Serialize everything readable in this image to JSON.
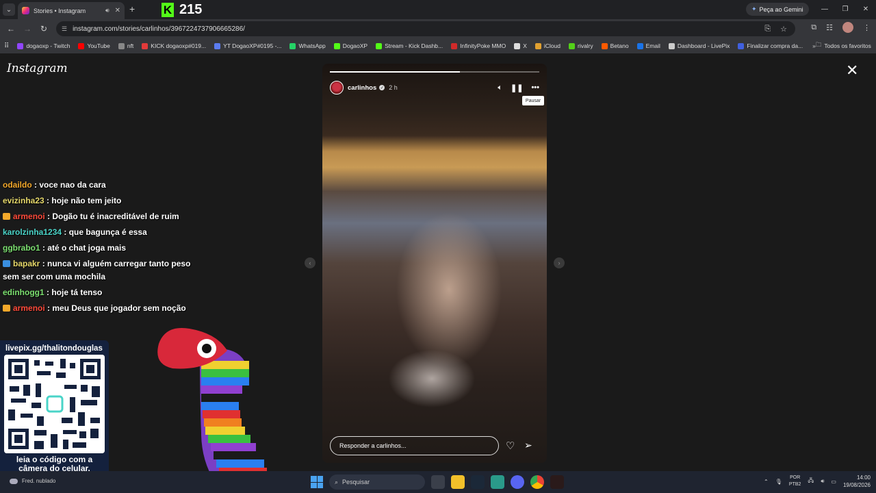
{
  "browser": {
    "tab_title": "Stories • Instagram",
    "new_tab": "+",
    "kick_count": "215",
    "gemini_label": "Peça ao Gemini",
    "url": "instagram.com/stories/carlinhos/3967224737906665286/",
    "bookmarks": [
      {
        "label": "dogaoxp - Twitch",
        "color": "#9146ff"
      },
      {
        "label": "YouTube",
        "color": "#ff0000"
      },
      {
        "label": "nft",
        "color": "#888888"
      },
      {
        "label": "KICK dogaoxp#019...",
        "color": "#e23a3a"
      },
      {
        "label": "YT DogaoXP#0195 -...",
        "color": "#5b7cf0"
      },
      {
        "label": "WhatsApp",
        "color": "#25d366"
      },
      {
        "label": "DogaoXP",
        "color": "#53fc18"
      },
      {
        "label": "Stream - Kick Dashb...",
        "color": "#53fc18"
      },
      {
        "label": "InfinityPoke MMO",
        "color": "#d02a2a"
      },
      {
        "label": "X",
        "color": "#dddddd"
      },
      {
        "label": "iCloud",
        "color": "#e0a030"
      },
      {
        "label": "rivalry",
        "color": "#53d018"
      },
      {
        "label": "Betano",
        "color": "#ff5a00"
      },
      {
        "label": "Email",
        "color": "#1a73e8"
      },
      {
        "label": "Dashboard - LivePix",
        "color": "#cccccc"
      },
      {
        "label": "Finalizar compra da...",
        "color": "#4060e0"
      }
    ],
    "bookmarks_all": "Todos os favoritos"
  },
  "instagram": {
    "logo": "Instagram",
    "story": {
      "username": "carlinhos",
      "time": "2 h",
      "progress": 0.62,
      "tooltip": "Pausar",
      "reply_placeholder": "Responder a carlinhos..."
    }
  },
  "chat": [
    {
      "user": "odaildo",
      "text": " : voce nao da cara",
      "color": "#f3a82a",
      "badge": ""
    },
    {
      "user": "evizinha23",
      "text": " : hoje não tem jeito",
      "color": "#e6d86a",
      "badge": ""
    },
    {
      "user": "armenoi",
      "text": " : Dogão tu é inacreditável de ruim",
      "color": "#ff4a3a",
      "badge": "crown"
    },
    {
      "user": "karolzinha1234",
      "text": " : que bagunça é essa",
      "color": "#4ad4c8",
      "badge": ""
    },
    {
      "user": "ggbrabo1",
      "text": " : até o chat joga mais",
      "color": "#7ce070",
      "badge": ""
    },
    {
      "user": "bapakr",
      "text": " : nunca vi alguém carregar tanto peso sem ser com uma mochila",
      "color": "#e6d86a",
      "badge": "blue"
    },
    {
      "user": "edinhogg1",
      "text": " : hoje tá tenso",
      "color": "#7ce070",
      "badge": ""
    },
    {
      "user": "armenoi",
      "text": " : meu Deus que jogador sem noção",
      "color": "#ff4a3a",
      "badge": "crown"
    }
  ],
  "overlay": {
    "qr_url": "livepix.gg/thalitondouglas",
    "qr_caption_1": "leia o código com a",
    "qr_caption_2": "câmera do celular."
  },
  "taskbar": {
    "weather": "Fred. nublado",
    "search_placeholder": "Pesquisar",
    "lang_1": "POR",
    "lang_2": "PTB2",
    "time": "14:00",
    "date": "19/08/2026"
  }
}
